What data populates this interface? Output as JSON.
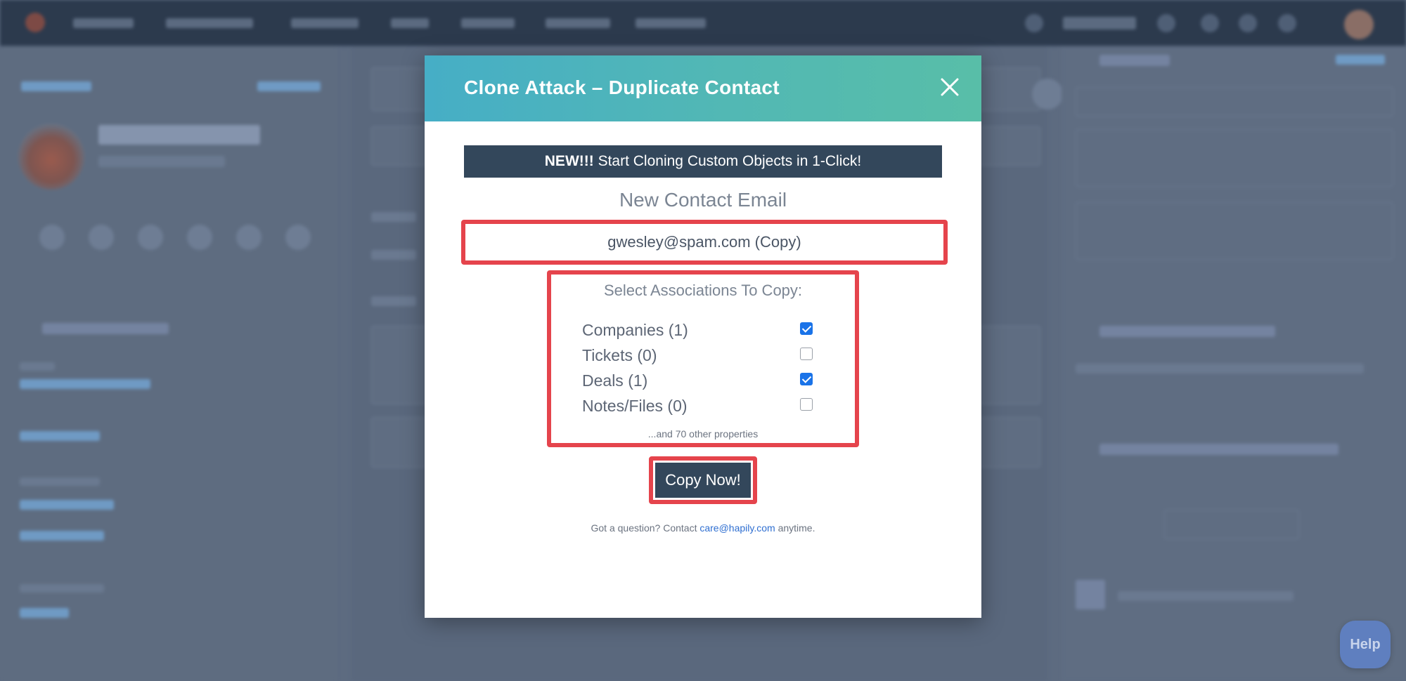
{
  "modal": {
    "title": "Clone Attack – Duplicate Contact",
    "promo_bold": "NEW!!!",
    "promo_text": " Start Cloning Custom Objects in 1-Click!",
    "email_heading": "New Contact Email",
    "email_value": "gwesley@spam.com (Copy)",
    "associations_title": "Select Associations To Copy:",
    "associations": [
      {
        "label": "Companies (1)",
        "checked": true
      },
      {
        "label": "Tickets (0)",
        "checked": false
      },
      {
        "label": "Deals (1)",
        "checked": true
      },
      {
        "label": "Notes/Files (0)",
        "checked": false
      }
    ],
    "other_properties": "...and 70 other properties",
    "copy_button": "Copy Now!",
    "footer_prefix": "Got a question? Contact ",
    "footer_email": "care@hapily.com",
    "footer_suffix": " anytime."
  },
  "help_button": "Help",
  "colors": {
    "header_gradient_start": "#46aec6",
    "header_gradient_end": "#58bea8",
    "highlight_red": "#e5444c",
    "navy": "#33475b",
    "checkbox_blue": "#1a73e8",
    "link_blue": "#2f6fd1"
  }
}
